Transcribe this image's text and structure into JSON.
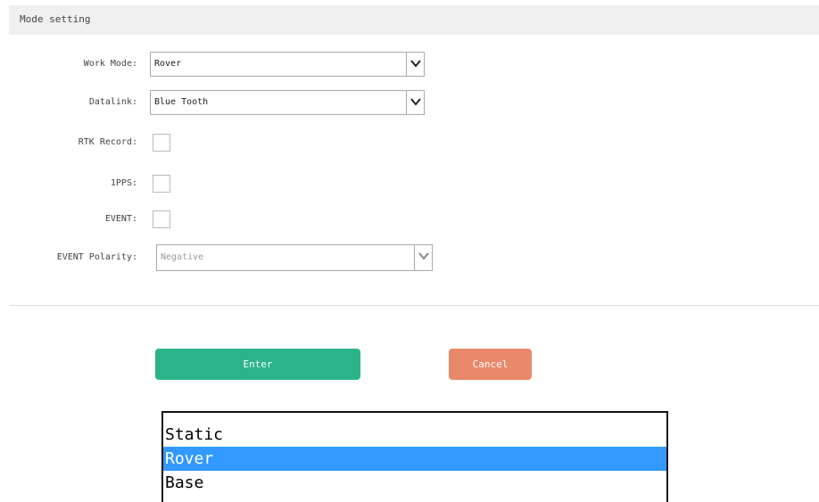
{
  "header": {
    "title": "Mode setting"
  },
  "form": {
    "work_mode": {
      "label": "Work Mode:",
      "value": "Rover"
    },
    "datalink": {
      "label": "Datalink:",
      "value": "Blue Tooth"
    },
    "rtk_record": {
      "label": "RTK Record:",
      "checked": false
    },
    "pps": {
      "label": "1PPS:",
      "checked": false
    },
    "event": {
      "label": "EVENT:",
      "checked": false
    },
    "event_polarity": {
      "label": "EVENT Polarity:",
      "value": "Negative",
      "disabled": true
    }
  },
  "buttons": {
    "enter": "Enter",
    "cancel": "Cancel"
  },
  "dropdown": {
    "options": [
      "Static",
      "Rover",
      "Base"
    ],
    "selected": "Rover"
  },
  "colors": {
    "enter": "#2bb38a",
    "cancel": "#e8896a",
    "highlight": "#3399ff"
  }
}
